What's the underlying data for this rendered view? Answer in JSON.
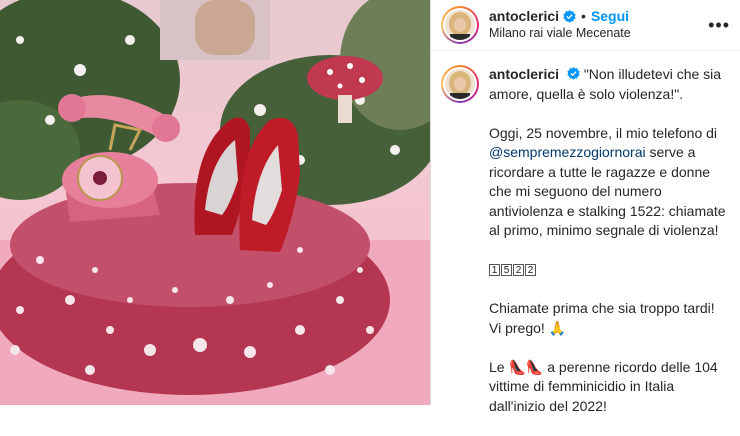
{
  "post": {
    "username": "antoclerici",
    "follow_label": "Segui",
    "separator": "•",
    "location": "Milano rai viale Mecenate",
    "more_label": "•••"
  },
  "caption": {
    "username": "antoclerici",
    "line1": "\"Non illudetevi che sia amore, quella è solo violenza!\".",
    "p2_before": "Oggi, 25 novembre, il mio telefono di ",
    "mention": "@sempremezzogiornorai",
    "p2_after": " serve a ricordare a tutte le ragazze e donne che mi seguono del numero antiviolenza e stalking 1522: chiamate al primo, minimo segnale di violenza!",
    "number_digits": [
      "1",
      "5",
      "2",
      "2"
    ],
    "p4": "Chiamate prima che sia troppo tardi! Vi prego!",
    "pray_emoji": "🙏",
    "p5_prefix": "Le ",
    "shoe_emojis": "👠👠",
    "p5_after": " a perenne ricordo delle 104 vittime di femminicidio in Italia dall'inizio del 2022!"
  },
  "colors": {
    "follow": "#0095f6",
    "mention": "#00376b",
    "shoe_red": "#b01621",
    "phone_pink": "#e6809a",
    "mushroom_cap": "#b93a55"
  },
  "icons": {
    "verified": "verified-badge-icon",
    "more": "more-options-icon",
    "pray": "pray-emoji",
    "shoes": "high-heel-emoji"
  }
}
